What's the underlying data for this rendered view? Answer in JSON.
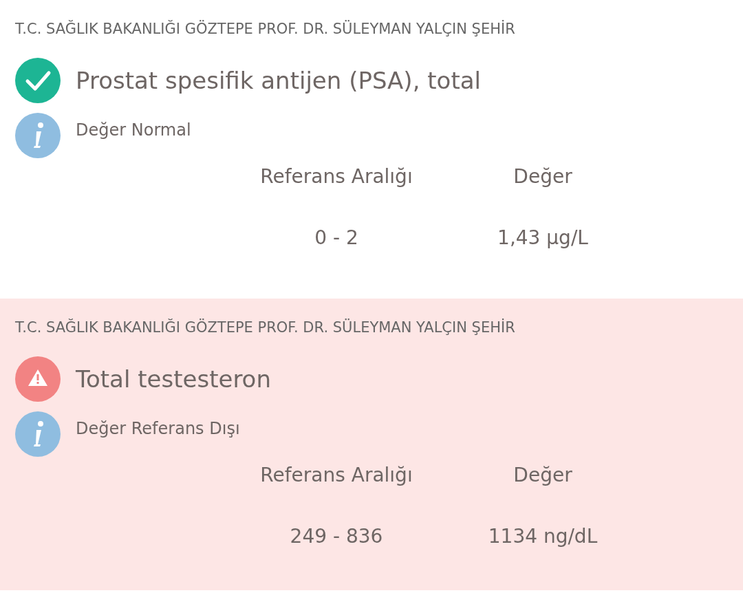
{
  "results": [
    {
      "kind": "normal",
      "hospital": "T.C. SAĞLIK BAKANLIĞI GÖZTEPE PROF. DR. SÜLEYMAN YALÇIN ŞEHİR",
      "test": "Prostat spesifik antijen (PSA), total",
      "note": "Değer Normal",
      "range_label": "Referans Aralığı",
      "value_label": "Değer",
      "range": "0 - 2",
      "value": "1,43 µg/L"
    },
    {
      "kind": "abnormal",
      "hospital": "T.C. SAĞLIK BAKANLIĞI GÖZTEPE PROF. DR. SÜLEYMAN YALÇIN ŞEHİR",
      "test": "Total testesteron",
      "note": "Değer Referans Dışı",
      "range_label": "Referans Aralığı",
      "value_label": "Değer",
      "range": "249 - 836",
      "value": "1134 ng/dL"
    }
  ]
}
